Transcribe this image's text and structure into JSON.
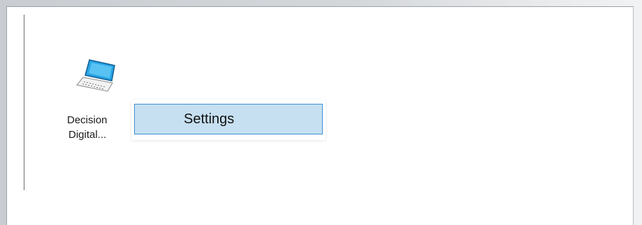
{
  "desktop_item": {
    "label_line1": "Decision",
    "label_line2": "Digital...",
    "icon": "laptop-icon"
  },
  "rename_box": {
    "value": "Settings"
  },
  "colors": {
    "selection_fill": "#c6e0f1",
    "selection_border": "#3f8fd0",
    "laptop_screen": "#29a4e6"
  }
}
